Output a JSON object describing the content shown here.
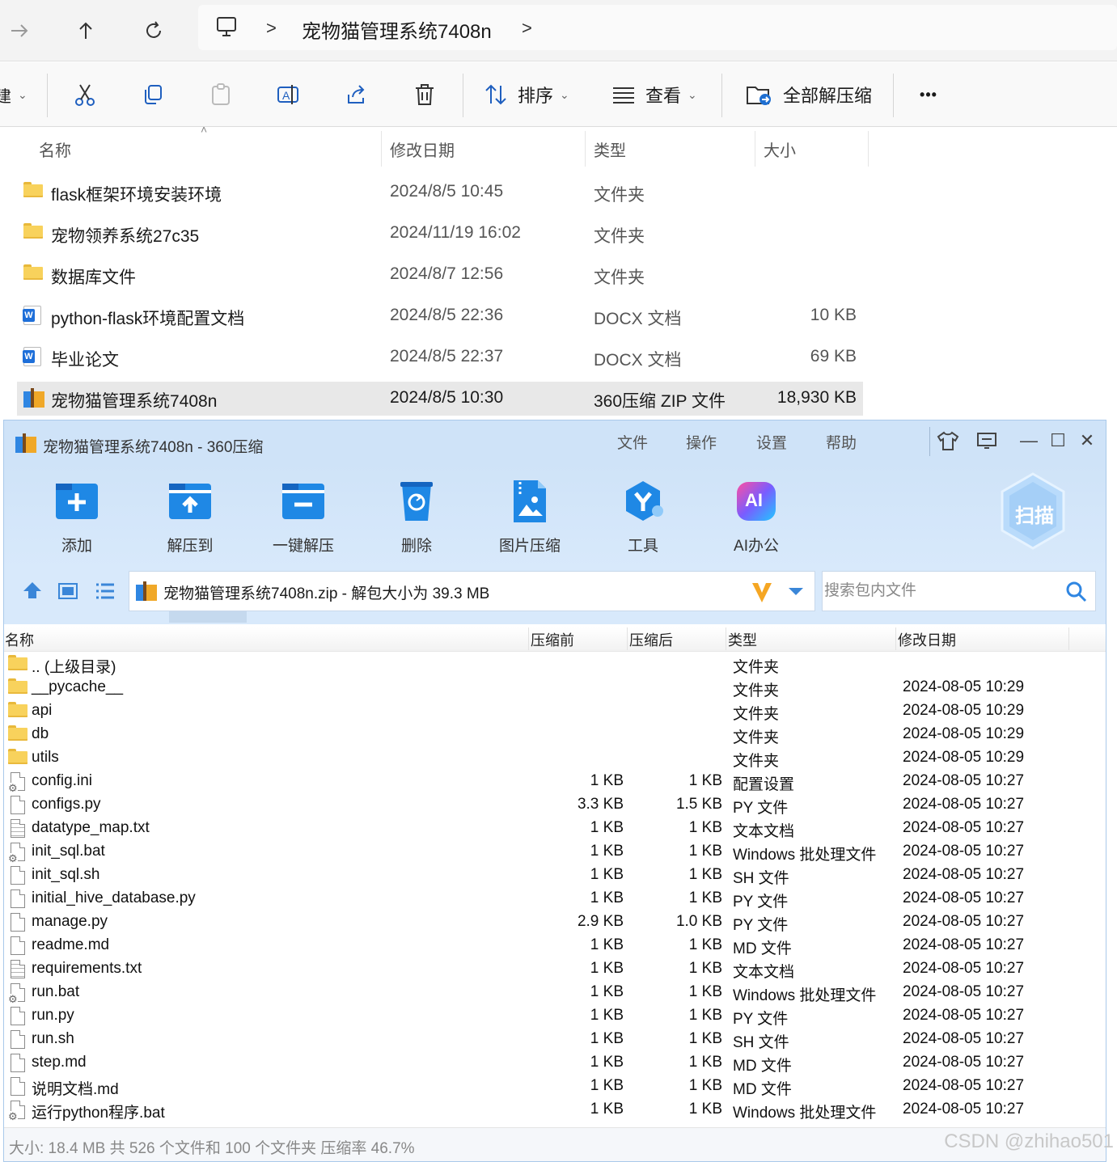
{
  "explorer": {
    "address": {
      "crumb": "宠物猫管理系统7408n",
      "separator": ">"
    },
    "nav_icons": [
      "forward-arrow-icon",
      "up-arrow-icon",
      "refresh-icon",
      "computer-icon"
    ],
    "cmd": {
      "partial_label": "建",
      "sort_label": "排序",
      "view_label": "查看",
      "extract_all_label": "全部解压缩",
      "more_label": "•••"
    },
    "columns": {
      "name": "名称",
      "date": "修改日期",
      "type": "类型",
      "size": "大小"
    },
    "rows": [
      {
        "icon": "folder-icon",
        "name": "flask框架环境安装环境",
        "date": "2024/8/5 10:45",
        "type": "文件夹",
        "size": ""
      },
      {
        "icon": "folder-icon",
        "name": "宠物领养系统27c35",
        "date": "2024/11/19 16:02",
        "type": "文件夹",
        "size": ""
      },
      {
        "icon": "folder-icon",
        "name": "数据库文件",
        "date": "2024/8/7 12:56",
        "type": "文件夹",
        "size": ""
      },
      {
        "icon": "word-doc-icon",
        "name": "python-flask环境配置文档",
        "date": "2024/8/5 22:36",
        "type": "DOCX 文档",
        "size": "10 KB"
      },
      {
        "icon": "word-doc-icon",
        "name": "毕业论文",
        "date": "2024/8/5 22:37",
        "type": "DOCX 文档",
        "size": "69 KB"
      },
      {
        "icon": "zip-archive-icon",
        "name": "宠物猫管理系统7408n",
        "date": "2024/8/5 10:30",
        "type": "360压缩 ZIP 文件",
        "size": "18,930 KB",
        "selected": true
      }
    ]
  },
  "zip": {
    "title": "宠物猫管理系统7408n - 360压缩",
    "menu": [
      "文件",
      "操作",
      "设置",
      "帮助"
    ],
    "window_controls": {
      "minimize": "—",
      "maximize": "☐",
      "close": "✕"
    },
    "tools": [
      {
        "label": "添加",
        "icon": "add-icon"
      },
      {
        "label": "解压到",
        "icon": "extract-to-icon"
      },
      {
        "label": "一键解压",
        "icon": "one-click-extract-icon"
      },
      {
        "label": "删除",
        "icon": "delete-icon"
      },
      {
        "label": "图片压缩",
        "icon": "image-compress-icon"
      },
      {
        "label": "工具",
        "icon": "tools-icon"
      },
      {
        "label": "AI办公",
        "icon": "ai-office-icon"
      }
    ],
    "ai_badge": "AI",
    "scan_label": "扫描",
    "path_text": "宠物猫管理系统7408n.zip - 解包大小为 39.3 MB",
    "search_placeholder": "搜索包内文件",
    "columns": {
      "name": "名称",
      "pre": "压缩前",
      "post": "压缩后",
      "type": "类型",
      "date": "修改日期"
    },
    "rows": [
      {
        "icon": "folder-icon",
        "name": ".. (上级目录)",
        "pre": "",
        "post": "",
        "type": "文件夹",
        "date": ""
      },
      {
        "icon": "folder-icon",
        "name": "__pycache__",
        "pre": "",
        "post": "",
        "type": "文件夹",
        "date": "2024-08-05 10:29"
      },
      {
        "icon": "folder-icon",
        "name": "api",
        "pre": "",
        "post": "",
        "type": "文件夹",
        "date": "2024-08-05 10:29"
      },
      {
        "icon": "folder-icon",
        "name": "db",
        "pre": "",
        "post": "",
        "type": "文件夹",
        "date": "2024-08-05 10:29"
      },
      {
        "icon": "folder-icon",
        "name": "utils",
        "pre": "",
        "post": "",
        "type": "文件夹",
        "date": "2024-08-05 10:29"
      },
      {
        "icon": "settings-file-icon",
        "name": "config.ini",
        "pre": "1 KB",
        "post": "1 KB",
        "type": "配置设置",
        "date": "2024-08-05 10:27"
      },
      {
        "icon": "file-icon",
        "name": "configs.py",
        "pre": "3.3 KB",
        "post": "1.5 KB",
        "type": "PY 文件",
        "date": "2024-08-05 10:27"
      },
      {
        "icon": "text-file-icon",
        "name": "datatype_map.txt",
        "pre": "1 KB",
        "post": "1 KB",
        "type": "文本文档",
        "date": "2024-08-05 10:27"
      },
      {
        "icon": "batch-file-icon",
        "name": "init_sql.bat",
        "pre": "1 KB",
        "post": "1 KB",
        "type": "Windows 批处理文件",
        "date": "2024-08-05 10:27"
      },
      {
        "icon": "file-icon",
        "name": "init_sql.sh",
        "pre": "1 KB",
        "post": "1 KB",
        "type": "SH 文件",
        "date": "2024-08-05 10:27"
      },
      {
        "icon": "file-icon",
        "name": "initial_hive_database.py",
        "pre": "1 KB",
        "post": "1 KB",
        "type": "PY 文件",
        "date": "2024-08-05 10:27"
      },
      {
        "icon": "file-icon",
        "name": "manage.py",
        "pre": "2.9 KB",
        "post": "1.0 KB",
        "type": "PY 文件",
        "date": "2024-08-05 10:27"
      },
      {
        "icon": "file-icon",
        "name": "readme.md",
        "pre": "1 KB",
        "post": "1 KB",
        "type": "MD 文件",
        "date": "2024-08-05 10:27"
      },
      {
        "icon": "text-file-icon",
        "name": "requirements.txt",
        "pre": "1 KB",
        "post": "1 KB",
        "type": "文本文档",
        "date": "2024-08-05 10:27"
      },
      {
        "icon": "batch-file-icon",
        "name": "run.bat",
        "pre": "1 KB",
        "post": "1 KB",
        "type": "Windows 批处理文件",
        "date": "2024-08-05 10:27"
      },
      {
        "icon": "file-icon",
        "name": "run.py",
        "pre": "1 KB",
        "post": "1 KB",
        "type": "PY 文件",
        "date": "2024-08-05 10:27"
      },
      {
        "icon": "file-icon",
        "name": "run.sh",
        "pre": "1 KB",
        "post": "1 KB",
        "type": "SH 文件",
        "date": "2024-08-05 10:27"
      },
      {
        "icon": "file-icon",
        "name": "step.md",
        "pre": "1 KB",
        "post": "1 KB",
        "type": "MD 文件",
        "date": "2024-08-05 10:27"
      },
      {
        "icon": "file-icon",
        "name": "说明文档.md",
        "pre": "1 KB",
        "post": "1 KB",
        "type": "MD 文件",
        "date": "2024-08-05 10:27"
      },
      {
        "icon": "batch-file-icon",
        "name": "运行python程序.bat",
        "pre": "1 KB",
        "post": "1 KB",
        "type": "Windows 批处理文件",
        "date": "2024-08-05 10:27"
      }
    ],
    "status": "大小: 18.4 MB 共 526 个文件和 100 个文件夹 压缩率 46.7%"
  },
  "watermark": "CSDN @zhihao501",
  "colors": {
    "accent_blue": "#2f86e2",
    "zip_bg": "#cfe3f8",
    "selected_row": "#e8e8e8"
  }
}
